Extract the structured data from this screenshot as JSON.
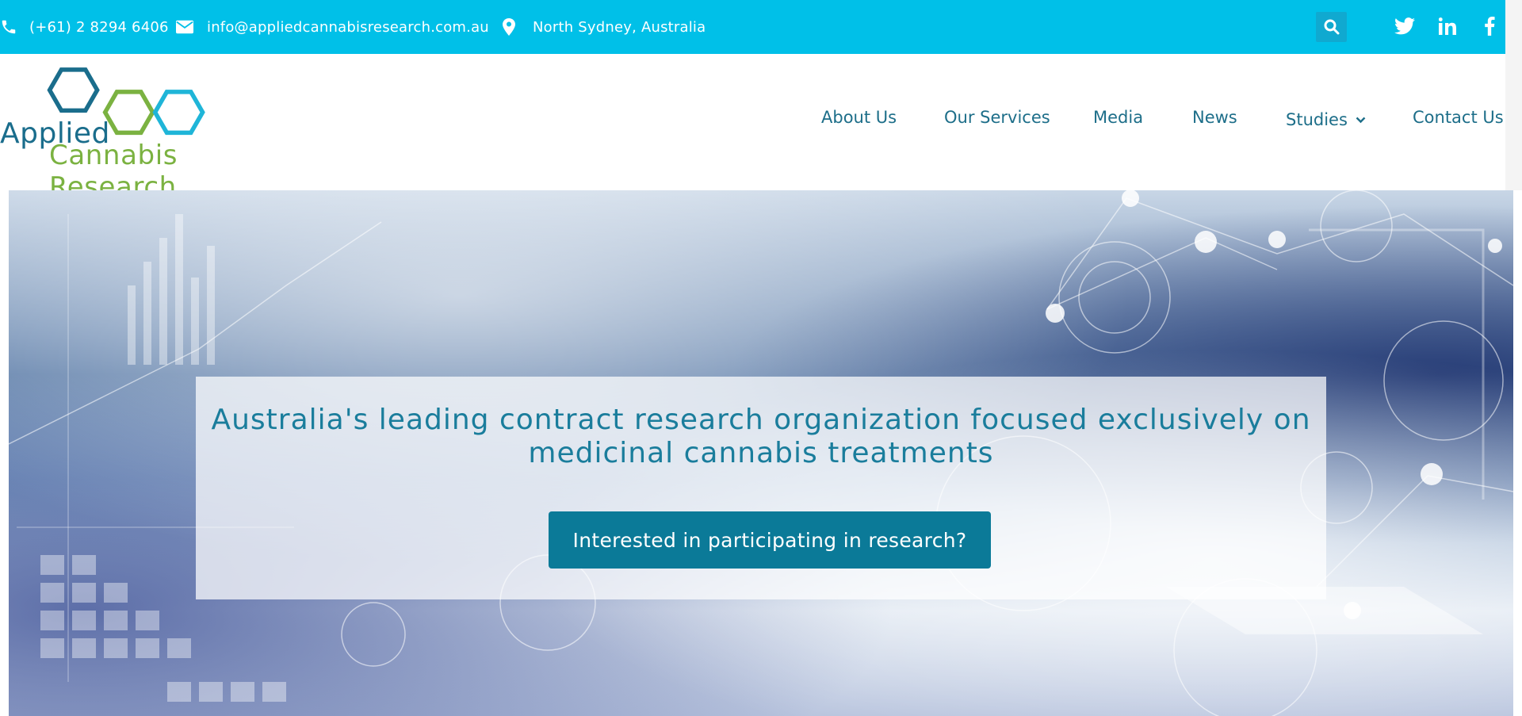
{
  "topbar": {
    "phone": "(+61) 2 8294 6406",
    "email": "info@appliedcannabisresearch.com.au",
    "location": "North Sydney, Australia",
    "icons": [
      "phone-icon",
      "envelope-icon",
      "map-pin-icon",
      "search-icon",
      "twitter-icon",
      "linkedin-icon",
      "facebook-icon"
    ]
  },
  "logo": {
    "line1": "Applied",
    "line2": "Cannabis Research"
  },
  "nav": {
    "items": [
      "About Us",
      "Our Services",
      "Media",
      "News",
      "Studies",
      "Contact Us"
    ]
  },
  "hero": {
    "title": "Australia's leading contract research organization focused exclusively on medicinal cannabis treatments",
    "cta": "Interested in participating in research?"
  },
  "colors": {
    "topbar": "#00c0e8",
    "brand_blue": "#1d6e89",
    "brand_green": "#7bb241",
    "cta": "#0b7a98"
  }
}
